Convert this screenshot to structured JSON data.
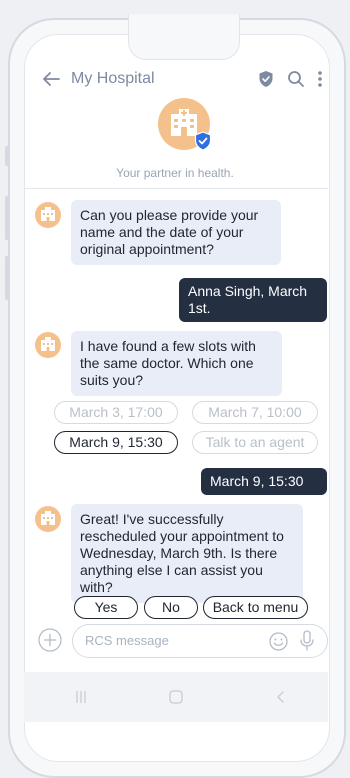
{
  "app": {
    "title": "My Hospital",
    "tagline": "Your partner in health."
  },
  "colors": {
    "accent": "#243042",
    "brand": "#f4c18d",
    "incoming": "#e8edf7",
    "verified": "#2f6fe0"
  },
  "icons": [
    "back-arrow-icon",
    "shield-icon",
    "search-icon",
    "more-vert-icon",
    "hospital-icon",
    "verified-badge-icon",
    "plus-icon",
    "emoji-icon",
    "mic-icon",
    "recents-icon",
    "home-icon",
    "back-icon"
  ],
  "messages": [
    {
      "from": "bot",
      "text": "Can you please provide your name and the date of your original appointment?"
    },
    {
      "from": "user",
      "text": "Anna Singh, March 1st."
    },
    {
      "from": "bot",
      "text": "I have found a few slots with the same doctor. Which one suits you?"
    },
    {
      "from": "user",
      "text": "March 9, 15:30"
    },
    {
      "from": "bot",
      "text": "Great! I've successfully rescheduled your appointment to Wednesday, March 9th. Is there anything else I can assist you with?"
    }
  ],
  "slot_chips": [
    {
      "label": "March 3, 17:00",
      "state": "faded"
    },
    {
      "label": "March 7, 10:00",
      "state": "faded"
    },
    {
      "label": "March 9, 15:30",
      "state": "selected"
    },
    {
      "label": "Talk to an agent",
      "state": "faded"
    }
  ],
  "reply_chips": [
    {
      "label": "Yes"
    },
    {
      "label": "No"
    },
    {
      "label": "Back to menu"
    }
  ],
  "composer": {
    "placeholder": "RCS message",
    "value": ""
  }
}
